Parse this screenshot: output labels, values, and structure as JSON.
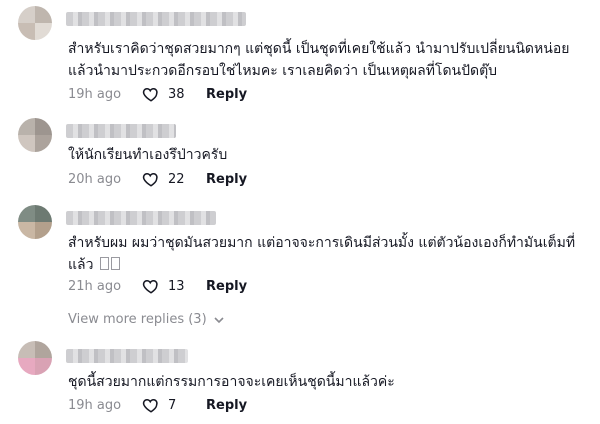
{
  "comments": [
    {
      "text_line1": "สำหรับเราคิดว่าชุดสวยมากๆ แต่ชุดนี้ เป็นชุดที่เคยใช้แล้ว นำมาปรับเปลี่ยนนิดหน่อย",
      "text_line2": "แล้วนำมาประกวดอีกรอบใช่ไหมคะ เราเลยคิดว่า เป็นเหตุผลที่โดนปัดตุ๊บ",
      "time": "19h ago",
      "likes": "38",
      "reply_label": "Reply"
    },
    {
      "text_line1": "ให้นักเรียนทำเองรึป่าวครับ",
      "time": "20h ago",
      "likes": "22",
      "reply_label": "Reply"
    },
    {
      "text_line1": "สำหรับผม ผมว่าชุดมันสวยมาก แต่อาจจะการเดินมีส่วนมั้ง แต่ตัวน้องเองก็ทำมันเต็มที่",
      "text_line2": "แล้ว",
      "time": "21h ago",
      "likes": "13",
      "reply_label": "Reply"
    },
    {
      "text_line1": "ชุดนี้สวยมากแต่กรรมการอาจจะเคยเห็นชุดนี้มาแล้วค่ะ",
      "time": "19h ago",
      "likes": "7",
      "reply_label": "Reply"
    }
  ],
  "view_more": "View more replies (3)",
  "icons": {
    "like": "heart-outline-icon",
    "view_more": "chevron-down-icon"
  },
  "colors": {
    "text": "#161823",
    "muted": "#8a8b91"
  }
}
